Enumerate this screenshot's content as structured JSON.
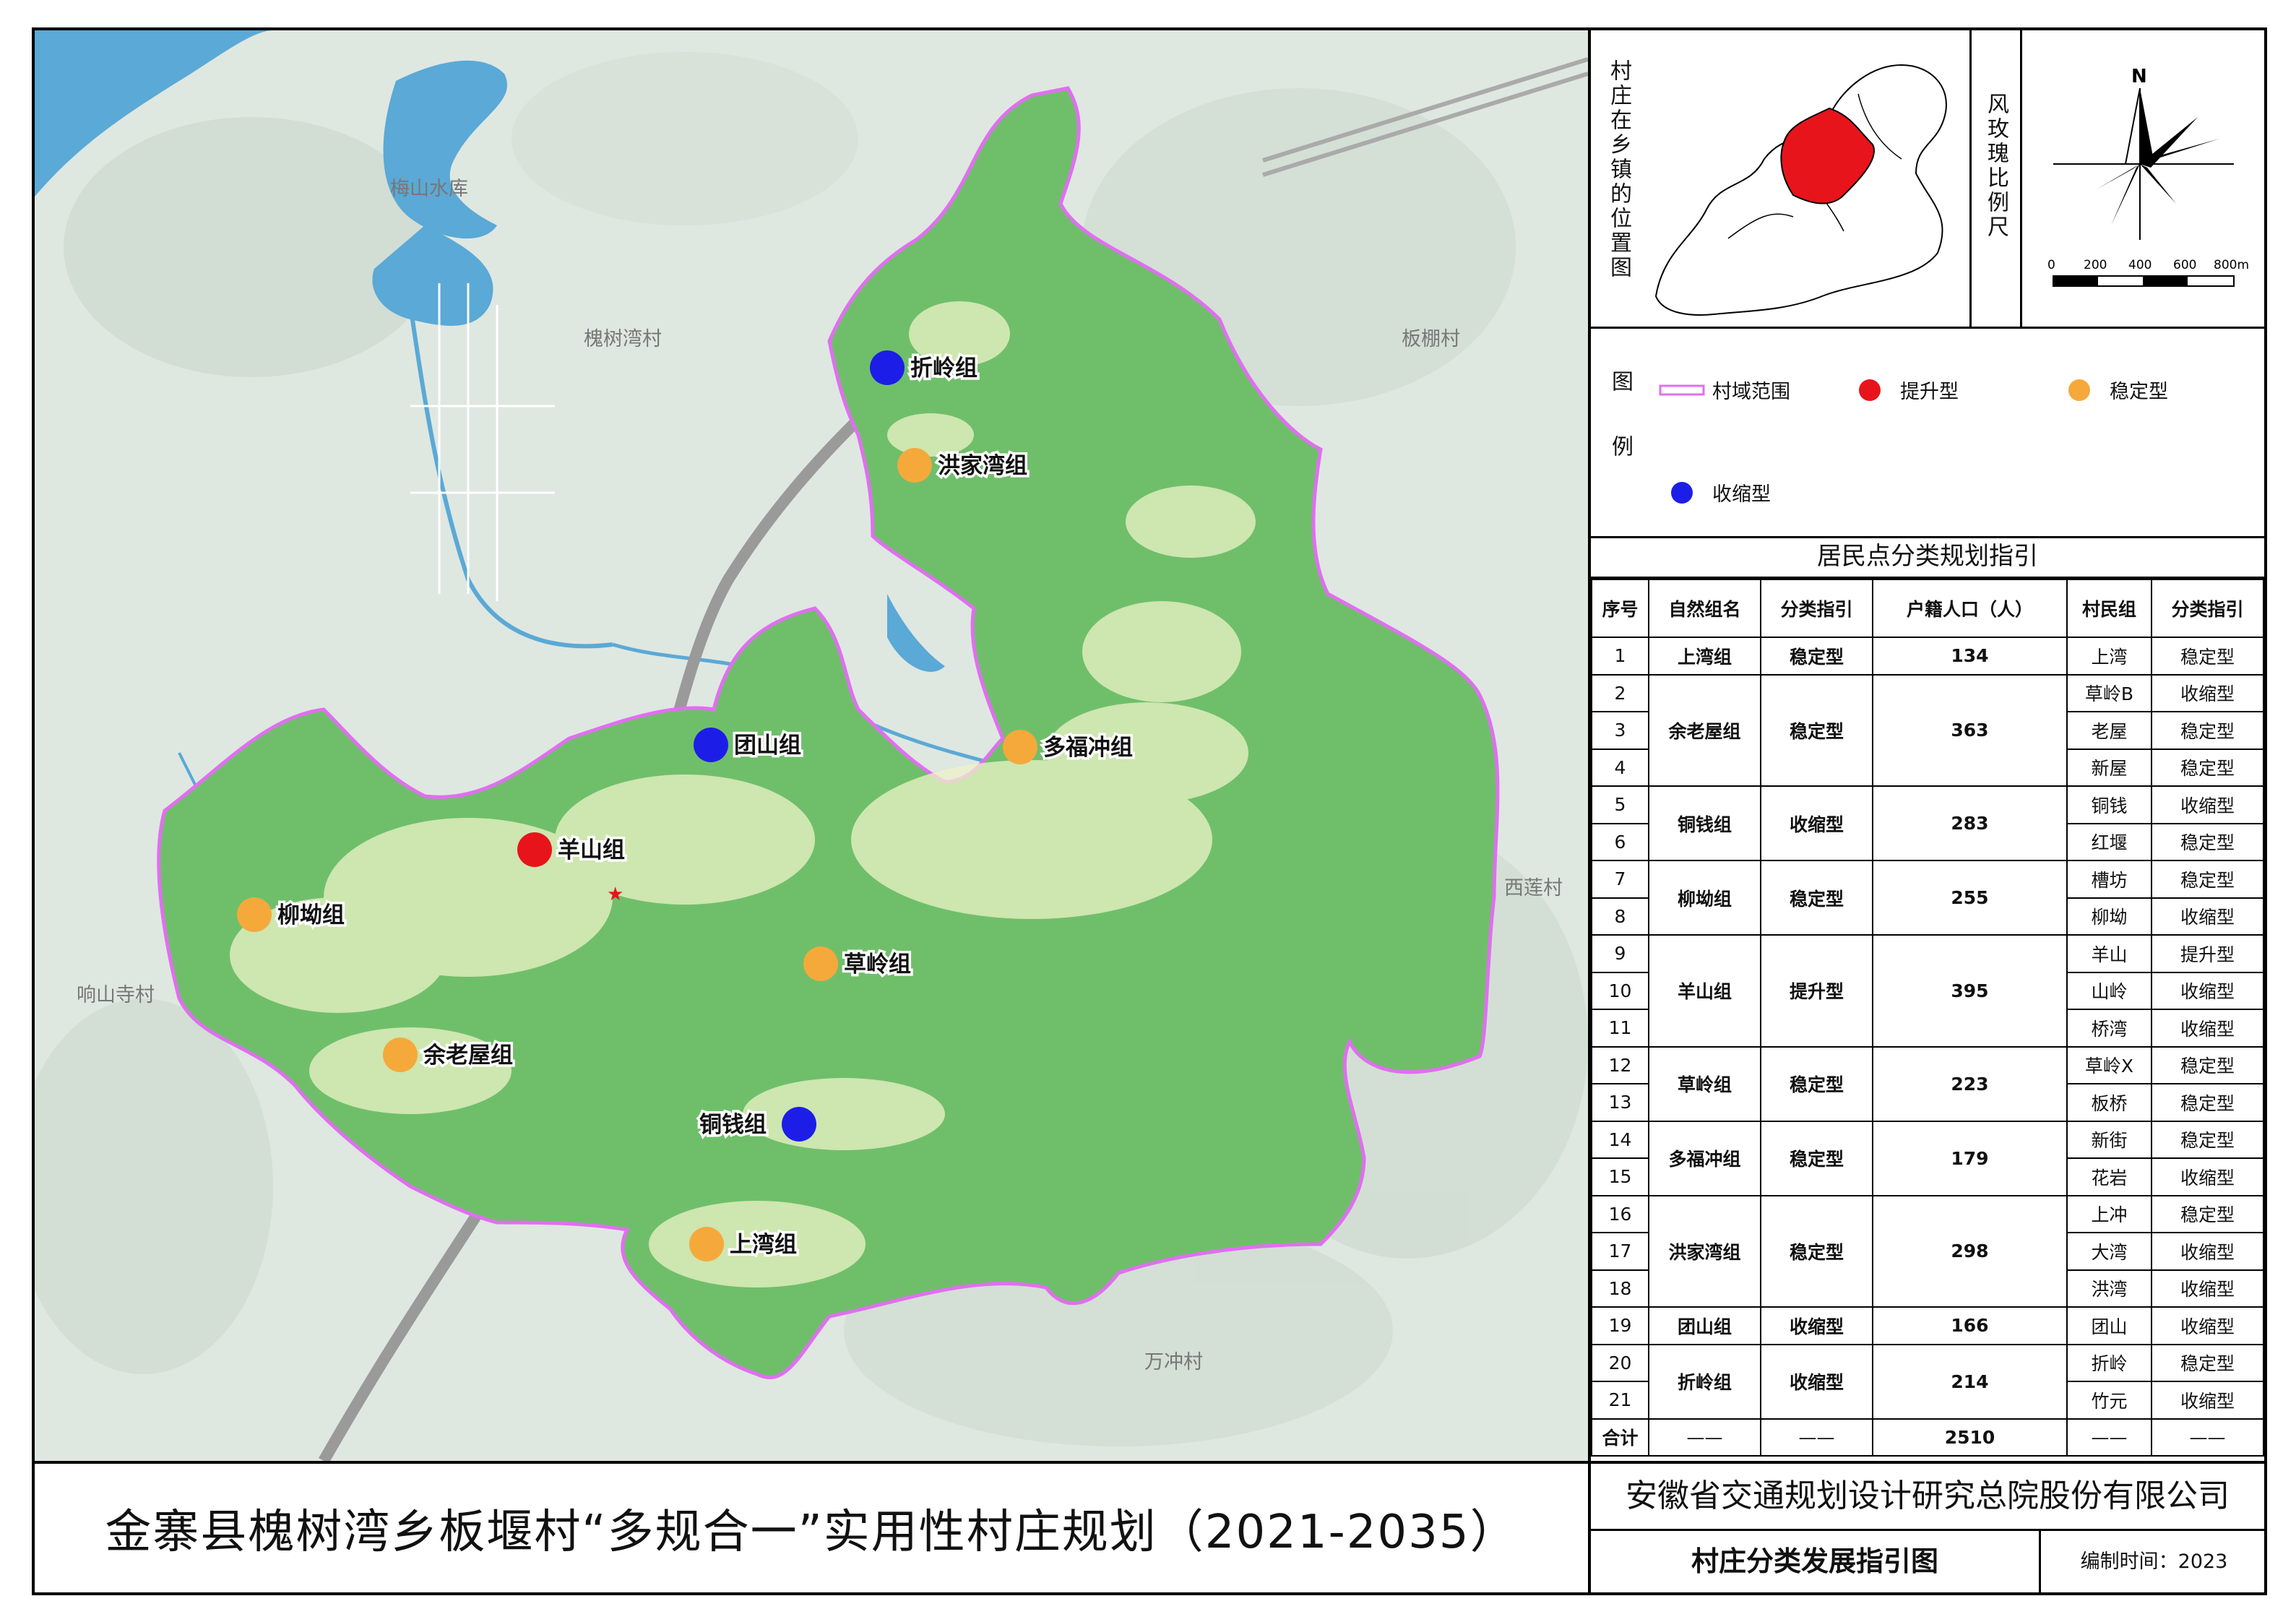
{
  "map": {
    "place_labels": [
      {
        "id": "meishan-reservoir",
        "text": "梅山水库"
      },
      {
        "id": "huaishuwan",
        "text": "槐树湾村"
      },
      {
        "id": "banpeng",
        "text": "板棚村"
      },
      {
        "id": "xianglian",
        "text": "西莲村"
      },
      {
        "id": "xiangshansi",
        "text": "响山寺村"
      },
      {
        "id": "wanchong",
        "text": "万冲村"
      }
    ],
    "groups": [
      {
        "id": "zheling",
        "name": "折岭组",
        "type": "收缩型"
      },
      {
        "id": "hongjiawan",
        "name": "洪家湾组",
        "type": "稳定型"
      },
      {
        "id": "tuanshan",
        "name": "团山组",
        "type": "收缩型"
      },
      {
        "id": "duofuchong",
        "name": "多福冲组",
        "type": "稳定型"
      },
      {
        "id": "yangshan",
        "name": "羊山组",
        "type": "提升型"
      },
      {
        "id": "liuao",
        "name": "柳坳组",
        "type": "稳定型"
      },
      {
        "id": "caoling",
        "name": "草岭组",
        "type": "稳定型"
      },
      {
        "id": "yulaowu",
        "name": "余老屋组",
        "type": "稳定型"
      },
      {
        "id": "tongqian",
        "name": "铜钱组",
        "type": "收缩型"
      },
      {
        "id": "shangwan",
        "name": "上湾组",
        "type": "稳定型"
      }
    ],
    "colors": {
      "village_green": "#6fbf6a",
      "boundary": "#e06ff0",
      "water": "#5aa9d6",
      "terrain": "#dfe7e1",
      "raise": "#e8141b",
      "stable": "#f5a93b",
      "shrink": "#1c1ee8"
    }
  },
  "inset": {
    "locator_title": "村庄在乡镇的位置图",
    "compass_title": "风玫瑰比例尺",
    "north": "N",
    "scale_ticks": [
      "0",
      "200",
      "400",
      "600",
      "800m"
    ]
  },
  "legend": {
    "title": "图例",
    "items": [
      {
        "label": "村域范围",
        "symbol": "boundary"
      },
      {
        "label": "提升型",
        "symbol": "raise"
      },
      {
        "label": "稳定型",
        "symbol": "stable"
      },
      {
        "label": "收缩型",
        "symbol": "shrink"
      }
    ]
  },
  "table": {
    "title": "居民点分类规划指引",
    "headers": [
      "序号",
      "自然组名",
      "分类指引",
      "户籍人口（人）",
      "村民组",
      "分类指引"
    ],
    "groups": [
      {
        "name": "上湾组",
        "type": "稳定型",
        "pop": "134",
        "rows": [
          [
            "1",
            "上湾",
            "稳定型"
          ]
        ]
      },
      {
        "name": "余老屋组",
        "type": "稳定型",
        "pop": "363",
        "rows": [
          [
            "2",
            "草岭B",
            "收缩型"
          ],
          [
            "3",
            "老屋",
            "稳定型"
          ],
          [
            "4",
            "新屋",
            "稳定型"
          ]
        ]
      },
      {
        "name": "铜钱组",
        "type": "收缩型",
        "pop": "283",
        "rows": [
          [
            "5",
            "铜钱",
            "收缩型"
          ],
          [
            "6",
            "红堰",
            "稳定型"
          ]
        ]
      },
      {
        "name": "柳坳组",
        "type": "稳定型",
        "pop": "255",
        "rows": [
          [
            "7",
            "槽坊",
            "稳定型"
          ],
          [
            "8",
            "柳坳",
            "收缩型"
          ]
        ]
      },
      {
        "name": "羊山组",
        "type": "提升型",
        "pop": "395",
        "rows": [
          [
            "9",
            "羊山",
            "提升型"
          ],
          [
            "10",
            "山岭",
            "收缩型"
          ],
          [
            "11",
            "桥湾",
            "收缩型"
          ]
        ]
      },
      {
        "name": "草岭组",
        "type": "稳定型",
        "pop": "223",
        "rows": [
          [
            "12",
            "草岭X",
            "稳定型"
          ],
          [
            "13",
            "板桥",
            "稳定型"
          ]
        ]
      },
      {
        "name": "多福冲组",
        "type": "稳定型",
        "pop": "179",
        "rows": [
          [
            "14",
            "新街",
            "稳定型"
          ],
          [
            "15",
            "花岩",
            "收缩型"
          ]
        ]
      },
      {
        "name": "洪家湾组",
        "type": "稳定型",
        "pop": "298",
        "rows": [
          [
            "16",
            "上冲",
            "稳定型"
          ],
          [
            "17",
            "大湾",
            "收缩型"
          ],
          [
            "18",
            "洪湾",
            "收缩型"
          ]
        ]
      },
      {
        "name": "团山组",
        "type": "收缩型",
        "pop": "166",
        "rows": [
          [
            "19",
            "团山",
            "收缩型"
          ]
        ]
      },
      {
        "name": "折岭组",
        "type": "收缩型",
        "pop": "214",
        "rows": [
          [
            "20",
            "折岭",
            "稳定型"
          ],
          [
            "21",
            "竹元",
            "收缩型"
          ]
        ]
      }
    ],
    "total": {
      "label": "合计",
      "dash": "——",
      "pop": "2510"
    }
  },
  "title_block": {
    "main_title": "金寨县槐树湾乡板堰村“多规合一”实用性村庄规划（2021-2035）",
    "organization": "安徽省交通规划设计研究总院股份有限公司",
    "drawing_name": "村庄分类发展指引图",
    "compile_date": "编制时间：2023"
  }
}
